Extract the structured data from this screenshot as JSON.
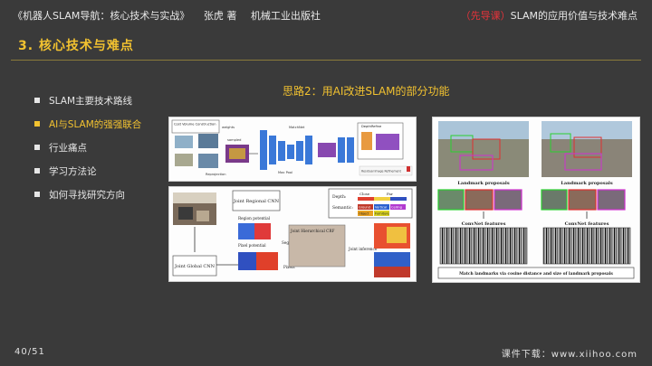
{
  "header": {
    "book_title": "《机器人SLAM导航：核心技术与实战》",
    "author": "张虎 著",
    "publisher": "机械工业出版社",
    "course_tag": "（先导课）",
    "course_title": "SLAM的应用价值与技术难点"
  },
  "section_title": "3. 核心技术与难点",
  "menu": {
    "items": [
      {
        "label": "SLAM主要技术路线",
        "active": false
      },
      {
        "label": "AI与SLAM的强强联合",
        "active": true
      },
      {
        "label": "行业痛点",
        "active": false
      },
      {
        "label": "学习方法论",
        "active": false
      },
      {
        "label": "如何寻找研究方向",
        "active": false
      }
    ]
  },
  "subheading": "思路2：用AI改进SLAM的部分功能",
  "figure1": {
    "cost_volume": "Cost Volume Construction",
    "weights": "weights",
    "sampled": "sampled",
    "reprojection": "Reprojection",
    "matching": "MatchNet",
    "depth_refine": "DepthRefine",
    "max_pool": "Max Pool",
    "caption": "Residual Image Refinement"
  },
  "figure2": {
    "regional_cnn": "Joint Regional CNN",
    "region_potential": "Region potential",
    "pixel_potential": "Pixel potential",
    "global_cnn": "Joint Global CNN",
    "segments": "Segments",
    "pixels": "Pixels",
    "crf": "Joint Hierarchical CRF",
    "inference": "Joint inference",
    "depth_label": "Depth:",
    "depth_close": "Close",
    "depth_far": "Far",
    "semantic_label": "Semantic:",
    "classes": [
      {
        "name": "Ground",
        "color": "#c0392b"
      },
      {
        "name": "Vertical",
        "color": "#2c62d0"
      },
      {
        "name": "Ceiling",
        "color": "#b23ad0"
      },
      {
        "name": "Object",
        "color": "#e8a020"
      },
      {
        "name": "Furniture",
        "color": "#d8d020"
      }
    ]
  },
  "figure3": {
    "landmark_left": "Landmark proposals",
    "landmark_right": "Landmark proposals",
    "convnet_left": "ConvNet features",
    "convnet_right": "ConvNet features",
    "match_caption": "Match landmarks via cosine distance and size of landmark proposals"
  },
  "footer": {
    "page": "40/51",
    "download": "课件下载：www.xiihoo.com"
  }
}
